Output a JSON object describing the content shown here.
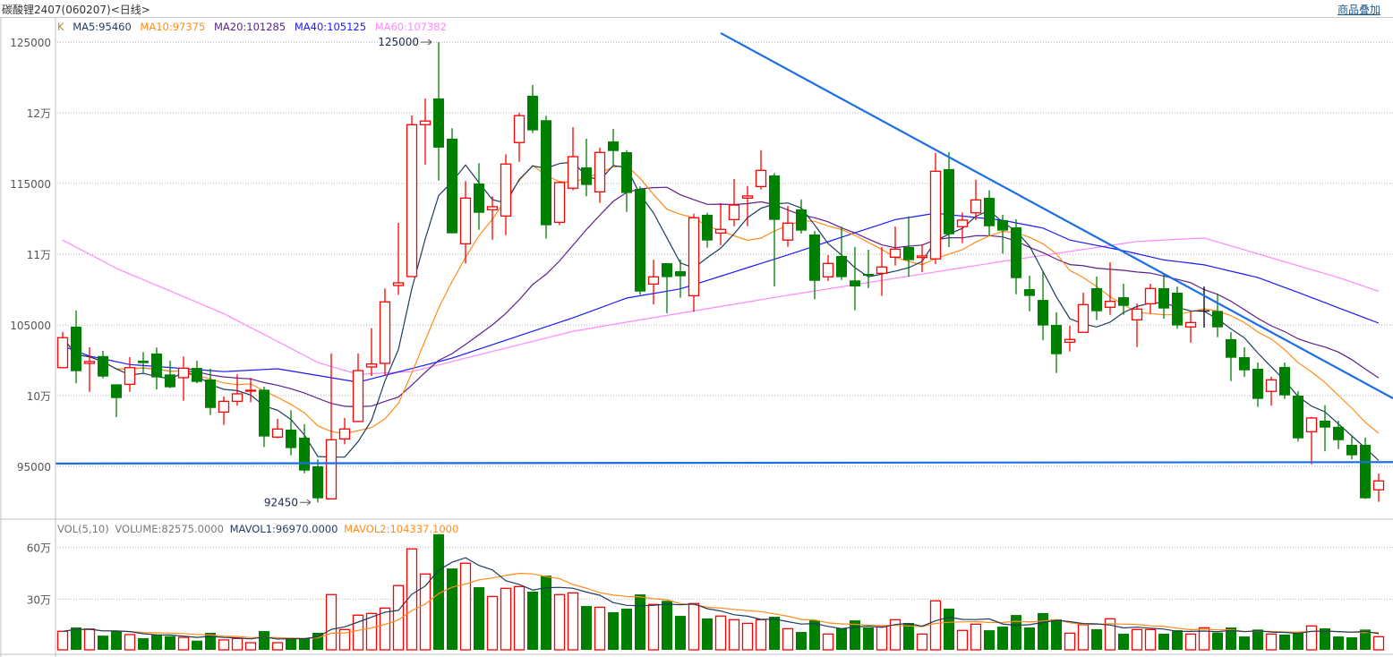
{
  "header": {
    "title": "碳酸锂2407(060207)<日线>",
    "overlay_link": "商品叠加"
  },
  "legend_main": {
    "k": "K",
    "ma5": "MA5:95460",
    "ma10": "MA10:97375",
    "ma20": "MA20:101285",
    "ma40": "MA40:105125",
    "ma60": "MA60:107382"
  },
  "legend_volume": {
    "vol": "VOL(5,10)",
    "volume": "VOLUME:82575.0000",
    "mavol1": "MAVOL1:96970.0000",
    "mavol2": "MAVOL2:104337.1000"
  },
  "colors": {
    "up": "#ff0000",
    "down": "#008000",
    "doji": "#000000",
    "ma5": "#1e3a5f",
    "ma10": "#ff8c1a",
    "ma20": "#5b1f8e",
    "ma40": "#1a1aff",
    "ma60": "#ff88ff",
    "k_label": "#b8862b",
    "mavol1": "#1e3a5f",
    "mavol2": "#ff8c1a",
    "trendline": "#1a6ee6",
    "grid": "#b0b0b0"
  },
  "chart_data": [
    {
      "type": "candlestick",
      "title": "碳酸锂2407 日线",
      "ylim": [
        91900,
        126000
      ],
      "yticks": [
        {
          "value": 125000,
          "label": "125000"
        },
        {
          "value": 120000,
          "label": "12万"
        },
        {
          "value": 115000,
          "label": "115000"
        },
        {
          "value": 110000,
          "label": "11万"
        },
        {
          "value": 105000,
          "label": "105000"
        },
        {
          "value": 100000,
          "label": "10万"
        },
        {
          "value": 95000,
          "label": "95000"
        }
      ],
      "grid": true,
      "ohlc_fields": [
        "open",
        "high",
        "low",
        "close"
      ],
      "ohlc": [
        [
          101980,
          104500,
          101980,
          104100
        ],
        [
          104880,
          106030,
          100870,
          101730
        ],
        [
          102280,
          103420,
          100270,
          102410
        ],
        [
          102800,
          103170,
          101220,
          101350
        ],
        [
          100800,
          100800,
          98480,
          99830
        ],
        [
          100800,
          102720,
          100270,
          101980
        ],
        [
          102470,
          103080,
          101580,
          102300
        ],
        [
          102980,
          103400,
          100440,
          101290
        ],
        [
          101500,
          102470,
          100530,
          100590
        ],
        [
          101270,
          102770,
          99640,
          101940
        ],
        [
          101960,
          102470,
          100870,
          100970
        ],
        [
          101140,
          101900,
          98630,
          99130
        ],
        [
          98840,
          99940,
          97930,
          99600
        ],
        [
          99600,
          101500,
          99290,
          100130
        ],
        [
          100360,
          101270,
          99540,
          100380
        ],
        [
          100420,
          100630,
          96370,
          97110
        ],
        [
          97070,
          98360,
          96980,
          97640
        ],
        [
          97600,
          98970,
          95780,
          96290
        ],
        [
          97030,
          97980,
          94510,
          94700
        ],
        [
          95000,
          95490,
          92450,
          92740
        ],
        [
          92700,
          102980,
          92700,
          96880
        ],
        [
          96940,
          98420,
          96560,
          97640
        ],
        [
          98170,
          102980,
          98170,
          101770
        ],
        [
          102030,
          104770,
          101390,
          102240
        ],
        [
          102280,
          107580,
          101390,
          106630
        ],
        [
          107790,
          112220,
          107130,
          107980
        ],
        [
          108420,
          119810,
          108420,
          119160
        ],
        [
          119160,
          121020,
          116330,
          119420
        ],
        [
          121020,
          125000,
          115210,
          117540
        ],
        [
          118170,
          118910,
          111480,
          111480
        ],
        [
          110740,
          115170,
          109350,
          113970
        ],
        [
          115000,
          116440,
          111730,
          112930
        ],
        [
          113150,
          114100,
          111030,
          113360
        ],
        [
          112700,
          117070,
          111350,
          116380
        ],
        [
          117900,
          120000,
          116540,
          119800
        ],
        [
          121210,
          121970,
          118570,
          118760
        ],
        [
          119480,
          119800,
          111100,
          112050
        ],
        [
          112260,
          115150,
          112050,
          115070
        ],
        [
          114670,
          118990,
          114520,
          116900
        ],
        [
          116140,
          118170,
          114100,
          114900
        ],
        [
          114410,
          117540,
          113630,
          117200
        ],
        [
          117980,
          118860,
          116270,
          117300
        ],
        [
          117220,
          117360,
          113000,
          114330
        ],
        [
          114620,
          114790,
          107150,
          107360
        ],
        [
          107890,
          109620,
          106460,
          108400
        ],
        [
          109370,
          109370,
          105820,
          108380
        ],
        [
          108800,
          109620,
          106920,
          108440
        ],
        [
          107070,
          112870,
          105930,
          112580
        ],
        [
          112790,
          112930,
          110460,
          110970
        ],
        [
          111500,
          113630,
          110640,
          111760
        ],
        [
          112450,
          115320,
          111980,
          113480
        ],
        [
          113970,
          114830,
          111980,
          114120
        ],
        [
          114790,
          117360,
          114580,
          115930
        ],
        [
          115570,
          115740,
          107720,
          112430
        ],
        [
          111000,
          113420,
          110530,
          112200
        ],
        [
          113170,
          113880,
          111460,
          111670
        ],
        [
          111400,
          111630,
          106820,
          108120
        ],
        [
          108400,
          109940,
          108100,
          109350
        ],
        [
          109880,
          111950,
          108190,
          108380
        ],
        [
          108150,
          110510,
          106030,
          107720
        ],
        [
          108610,
          110320,
          107600,
          108480
        ],
        [
          108650,
          110510,
          107050,
          109100
        ],
        [
          109790,
          111960,
          109200,
          110360
        ],
        [
          110510,
          112680,
          108400,
          109580
        ],
        [
          109770,
          110680,
          108740,
          109880
        ],
        [
          109670,
          117160,
          109310,
          115870
        ],
        [
          116020,
          117220,
          110510,
          111410
        ],
        [
          111950,
          112960,
          110780,
          112410
        ],
        [
          112930,
          115260,
          112410,
          113840
        ],
        [
          113990,
          114520,
          111310,
          111980
        ],
        [
          112410,
          112790,
          110050,
          111670
        ],
        [
          111900,
          112470,
          107170,
          108310
        ],
        [
          107530,
          108480,
          105970,
          107050
        ],
        [
          106770,
          108820,
          103930,
          104960
        ],
        [
          105000,
          105890,
          101600,
          102930
        ],
        [
          103780,
          104940,
          103120,
          103970
        ],
        [
          104480,
          107280,
          104480,
          106440
        ],
        [
          107600,
          108420,
          105340,
          105970
        ],
        [
          106250,
          109430,
          105720,
          106670
        ],
        [
          106960,
          107910,
          105720,
          106350
        ],
        [
          105360,
          106520,
          103440,
          106120
        ],
        [
          106500,
          107910,
          105820,
          107580
        ],
        [
          107600,
          108570,
          105440,
          106160
        ],
        [
          107280,
          107720,
          104730,
          104960
        ],
        [
          104860,
          105930,
          103750,
          105170
        ],
        [
          105990,
          107720,
          104810,
          105990
        ],
        [
          105990,
          107150,
          104130,
          104830
        ],
        [
          103990,
          104500,
          101030,
          102680
        ],
        [
          102720,
          103420,
          101330,
          101790
        ],
        [
          101900,
          102340,
          99200,
          99770
        ],
        [
          100300,
          101330,
          99290,
          101120
        ],
        [
          102030,
          102340,
          99770,
          100020
        ],
        [
          100000,
          100320,
          96750,
          96980
        ],
        [
          97450,
          98500,
          95150,
          98420
        ],
        [
          98230,
          99320,
          96060,
          97740
        ],
        [
          97800,
          98230,
          96220,
          96850
        ],
        [
          96520,
          97110,
          95490,
          95780
        ],
        [
          96520,
          97030,
          92700,
          92740
        ],
        [
          93340,
          94490,
          92490,
          93970
        ]
      ],
      "moving_averages": [
        {
          "name": "MA5",
          "period": 5
        },
        {
          "name": "MA10",
          "period": 10
        },
        {
          "name": "MA20",
          "period": 20
        },
        {
          "name": "MA40",
          "points": [
            [
              0,
              103500
            ],
            [
              2,
              102800
            ],
            [
              5,
              102200
            ],
            [
              12,
              101700
            ],
            [
              16,
              101900
            ],
            [
              22,
              100950
            ],
            [
              29,
              102650
            ],
            [
              38,
              105500
            ],
            [
              42,
              106900
            ],
            [
              46,
              107550
            ],
            [
              54,
              109950
            ],
            [
              62,
              112450
            ],
            [
              65,
              112900
            ],
            [
              70,
              112400
            ],
            [
              73,
              111850
            ],
            [
              75,
              111000
            ],
            [
              79,
              110250
            ],
            [
              82,
              109600
            ],
            [
              85,
              109250
            ],
            [
              89,
              108350
            ],
            [
              92,
              107300
            ],
            [
              98,
              105125
            ]
          ]
        },
        {
          "name": "MA60",
          "points": [
            [
              0,
              111000
            ],
            [
              4,
              109000
            ],
            [
              12,
              105800
            ],
            [
              19,
              102350
            ],
            [
              22,
              101500
            ],
            [
              26,
              101700
            ],
            [
              30,
              102650
            ],
            [
              38,
              104550
            ],
            [
              42,
              105200
            ],
            [
              54,
              107100
            ],
            [
              70,
              109500
            ],
            [
              80,
              110900
            ],
            [
              85,
              111150
            ],
            [
              95,
              108350
            ],
            [
              98,
              107382
            ]
          ]
        }
      ],
      "annotations": [
        {
          "index": 28,
          "value": 125000,
          "label": "125000",
          "kind": "high"
        },
        {
          "index": 19,
          "value": 92450,
          "label": "92450",
          "kind": "low"
        }
      ],
      "drawn_lines": [
        {
          "name": "downtrend-line",
          "from": [
            49,
            125640
          ],
          "to": [
            99.07,
            99810
          ]
        },
        {
          "name": "support-line",
          "from": [
            -0.5,
            95200
          ],
          "to": [
            99.07,
            95300
          ]
        }
      ]
    },
    {
      "type": "bar",
      "title": "VOL(5,10)",
      "ylim": [
        0,
        700000
      ],
      "yticks": [
        {
          "value": 600000,
          "label": "60万"
        },
        {
          "value": 300000,
          "label": "30万"
        }
      ],
      "values": [
        113800,
        136000,
        127000,
        89000,
        114000,
        95000,
        74000,
        95000,
        86000,
        79000,
        60000,
        105000,
        64000,
        72000,
        48000,
        115000,
        48000,
        72000,
        72000,
        105000,
        326000,
        124000,
        207000,
        217000,
        248000,
        378000,
        590000,
        445000,
        675000,
        477000,
        507000,
        369000,
        315000,
        362000,
        372000,
        343000,
        436000,
        326000,
        336000,
        260000,
        253000,
        224000,
        245000,
        327000,
        269000,
        290000,
        203000,
        274000,
        188000,
        202000,
        181000,
        160000,
        181000,
        198000,
        129000,
        110000,
        177000,
        98000,
        132000,
        177000,
        136000,
        140000,
        181000,
        162000,
        98000,
        290000,
        245000,
        119000,
        155000,
        120000,
        141000,
        208000,
        136000,
        219000,
        183000,
        103000,
        152000,
        126000,
        186000,
        100000,
        124000,
        124000,
        100000,
        120000,
        98000,
        134000,
        107000,
        136000,
        84000,
        124000,
        98000,
        95000,
        107000,
        145000,
        131000,
        84000,
        79000,
        124000,
        82575
      ],
      "moving_averages": [
        {
          "name": "MAVOL1",
          "period": 5
        },
        {
          "name": "MAVOL2",
          "period": 10
        }
      ]
    }
  ]
}
